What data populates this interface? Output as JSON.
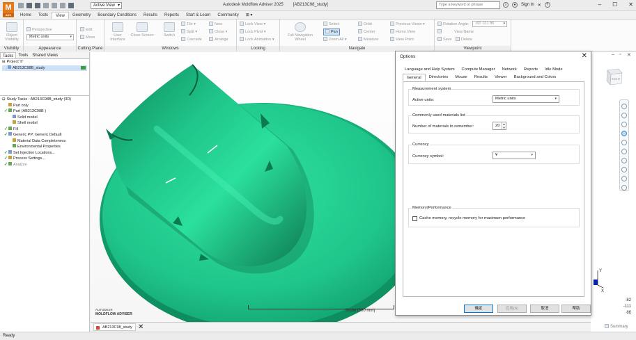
{
  "app": {
    "logo_letter": "M",
    "logo_sub": "ADV",
    "active_view": "Active View",
    "title": "Autodesk Moldflow Adviser 2025",
    "document": "[AB213C98_study]",
    "search_placeholder": "Type a keyword or phrase",
    "sign_in": "Sign In",
    "help": "?"
  },
  "ribbon_tabs": [
    "Home",
    "Tools",
    "View",
    "Geometry",
    "Boundary Conditions",
    "Results",
    "Reports",
    "Start & Learn",
    "Community",
    "⊞ ▾"
  ],
  "active_tab": "View",
  "ribbon": {
    "visibility": {
      "object_visibility": "Object Visibility",
      "label": "Visibility"
    },
    "appearance": {
      "perspective": "Perspective",
      "units": "Metric units",
      "label": "Appearance"
    },
    "cutting_plane": {
      "edit": "Edit",
      "move": "Move",
      "label": "Cutting Plane"
    },
    "windows": {
      "user_interface": "User Interface",
      "close_screen": "Close Screen",
      "switch": "Switch",
      "tile": "Tile ▾",
      "split": "Split ▾",
      "cascade": "Cascade",
      "new": "New",
      "close": "Close ▾",
      "arrange": "Arrange",
      "label": "Windows"
    },
    "locking": {
      "lock_view": "Lock View ▾",
      "lock_pivot": "Lock Pivot ▾",
      "lock_animation": "Lock Animation ▾",
      "label": "Locking"
    },
    "navigate": {
      "full_nav_wheel": "Full Navigation Wheel",
      "select": "Select",
      "pan": "Pan",
      "zoom_all": "Zoom All ▾",
      "orbit": "Orbit",
      "center": "Center",
      "measure": "Measure",
      "previous_views": "Previous Views ▾",
      "home_view": "Home View",
      "view_point": "View Point",
      "label": "Navigate"
    },
    "viewpoint": {
      "rotation_angle": "Rotation Angle:",
      "rotation_value": "-82 -111 86",
      "view_name": "View Name",
      "save": "Save",
      "delete": "Delete",
      "label": "Viewpoint"
    }
  },
  "left_panel": {
    "tabs": [
      "Tasks",
      "Tools",
      "Shared Views"
    ],
    "project_label": "Project 'II'",
    "project_item": "AB213C98B_study",
    "study_header": "Study Tasks : AB213C98B_study (3D)",
    "tasks": [
      {
        "text": "Part only",
        "mark": "",
        "indent": 1,
        "dim": false
      },
      {
        "text": "Part (AB213C98B )",
        "mark": "✓",
        "indent": 1,
        "dim": false
      },
      {
        "text": "Solid model",
        "mark": "",
        "indent": 3,
        "dim": false
      },
      {
        "text": "Shell model",
        "mark": "",
        "indent": 3,
        "dim": false
      },
      {
        "text": "Fill",
        "mark": "✓",
        "indent": 1,
        "dim": false
      },
      {
        "text": "Generic PP: Generic Default",
        "mark": "✓",
        "indent": 1,
        "dim": false
      },
      {
        "text": "Material Data Completeness",
        "mark": "",
        "indent": 3,
        "dim": false
      },
      {
        "text": "Environmental Properties",
        "mark": "",
        "indent": 3,
        "dim": false
      },
      {
        "text": "Set Injection Locations...",
        "mark": "✓",
        "indent": 1,
        "dim": false
      },
      {
        "text": "Process Settings...",
        "mark": "✓",
        "indent": 1,
        "dim": false
      },
      {
        "text": "Analyze",
        "mark": "✓",
        "indent": 1,
        "dim": true
      }
    ]
  },
  "viewport": {
    "brand_top": "AUTODESK",
    "brand_bottom": "MOLDFLOW ADVISER",
    "scale": "Scale (300 mm)",
    "doc_tab": "AB213C98_study",
    "model_color": "#1fc58a",
    "coords": [
      "-82",
      "-111",
      "86"
    ],
    "axis_y": "Y",
    "axis_x": "X",
    "viewcube_label": "RIGHT",
    "summary": "Summary"
  },
  "status": "Ready",
  "dialog": {
    "title": "Options",
    "tabs_row1": [
      "Language and Help System",
      "Compute Manager",
      "Network",
      "Reports",
      "Idle Mode"
    ],
    "tabs_row2": [
      "General",
      "Directories",
      "Mouse",
      "Results",
      "Viewer",
      "Background and Colors"
    ],
    "active_tab": "General",
    "measurement_system": {
      "group": "Measurement system",
      "label": "Active units:",
      "value": "Metric units"
    },
    "materials_list": {
      "group": "Commonly used materials list",
      "label": "Number of materials to remember:",
      "value": "20"
    },
    "currency": {
      "group": "Currency",
      "label": "Currency symbol:",
      "value": "¥"
    },
    "memory": {
      "group": "Memory/Performance",
      "checkbox": "Cache memory, recycle memory for maximum performance",
      "checked": false
    },
    "buttons": {
      "ok": "确定",
      "apply": "应用(A)",
      "cancel": "取消",
      "help": "帮助"
    }
  }
}
